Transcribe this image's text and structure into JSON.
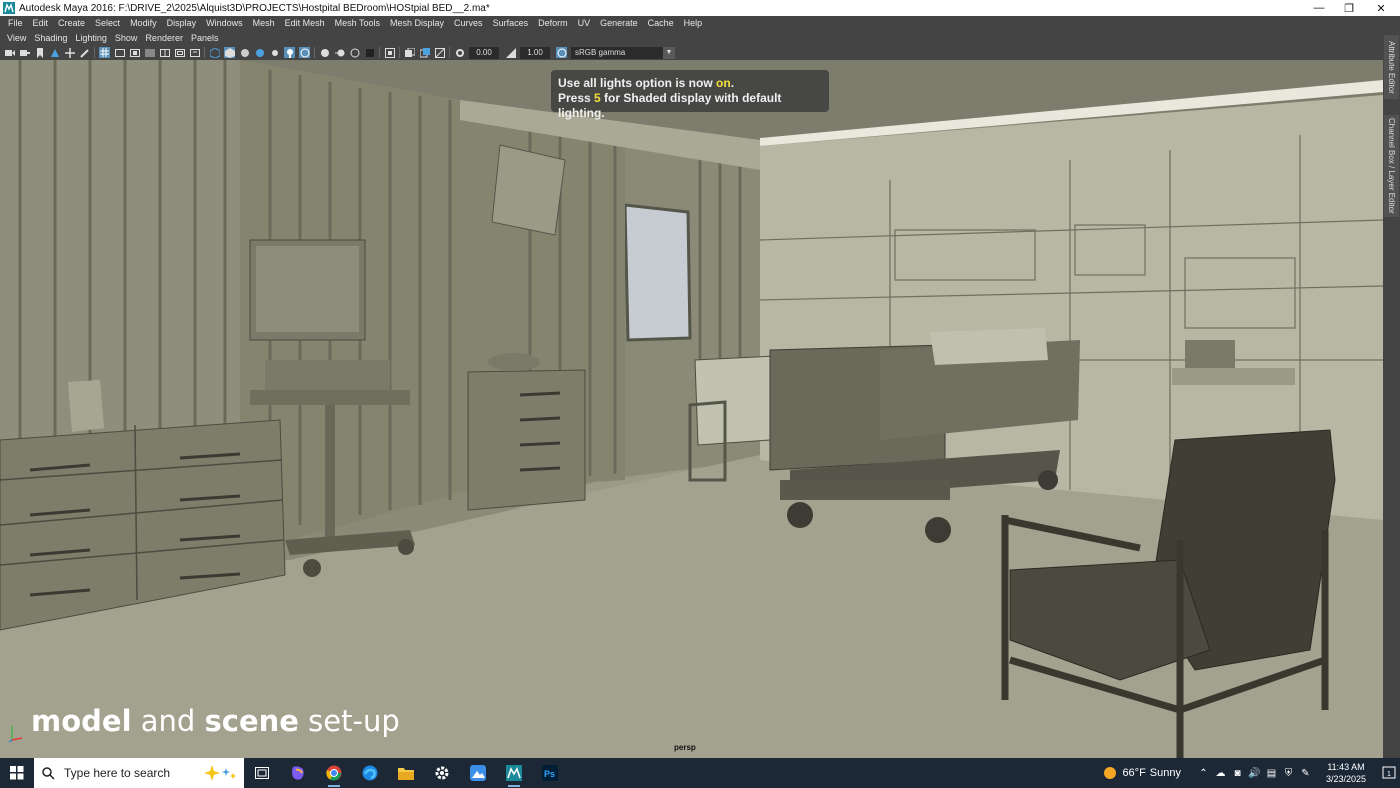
{
  "window": {
    "title": "Autodesk Maya 2016: F:\\DRIVE_2\\2025\\Alquist3D\\PROJECTS\\Hostpital BEDroom\\HOStpial BED__2.ma*",
    "minimize": "—",
    "restore": "❐",
    "close": "✕"
  },
  "menubar": {
    "items": [
      "File",
      "Edit",
      "Create",
      "Select",
      "Modify",
      "Display",
      "Windows",
      "Mesh",
      "Edit Mesh",
      "Mesh Tools",
      "Mesh Display",
      "Curves",
      "Surfaces",
      "Deform",
      "UV",
      "Generate",
      "Cache",
      "Help"
    ]
  },
  "panel_menu": {
    "items": [
      "View",
      "Shading",
      "Lighting",
      "Show",
      "Renderer",
      "Panels"
    ]
  },
  "toolbar": {
    "exposure": "0.00",
    "gamma": "1.00",
    "color_space": "sRGB gamma"
  },
  "viewport": {
    "hud_line1_a": "Use all lights option is now ",
    "hud_line1_b": "on",
    "hud_line1_c": ".",
    "hud_line2_a": "Press ",
    "hud_line2_b": "5",
    "hud_line2_c": " for Shaded display with default lighting.",
    "camera": "persp",
    "overlay_word1": "model",
    "overlay_word2": " and ",
    "overlay_word3": "scene",
    "overlay_word4": " set-up"
  },
  "right_tabs": {
    "tab1": "Attribute Editor",
    "tab2": "Channel Box / Layer Editor"
  },
  "taskbar": {
    "search_placeholder": "Type here to search",
    "weather_temp": "66°F",
    "weather_cond": "Sunny",
    "time": "11:43 AM",
    "date": "3/23/2025",
    "notification_count": "1"
  },
  "colors": {
    "maya_ui": "#444444",
    "highlight_blue": "#5a8fb8",
    "hud_highlight": "#f4e03c",
    "taskbar": "#1c2836"
  }
}
